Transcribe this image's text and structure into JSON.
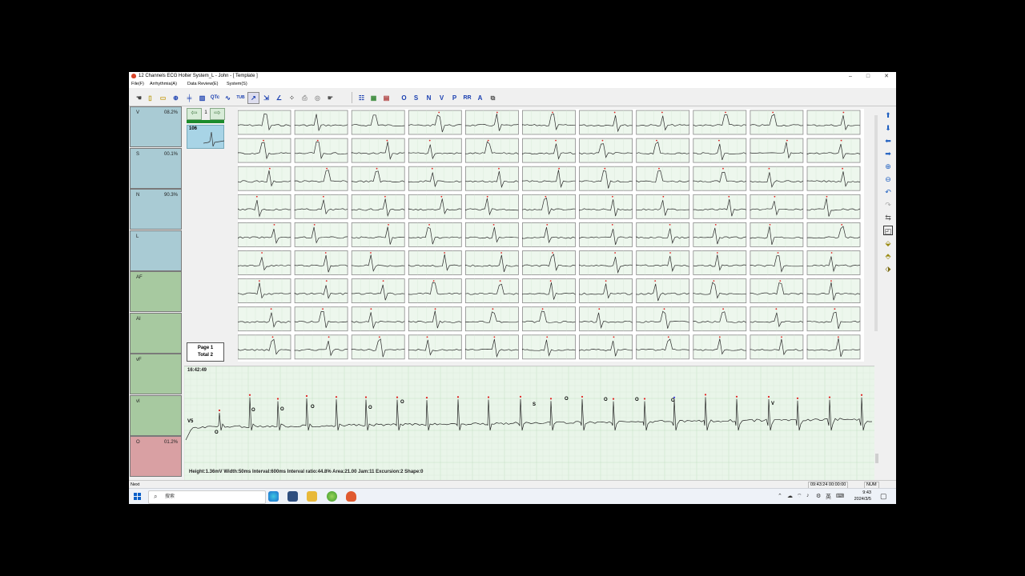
{
  "window": {
    "title": "12 Channels ECG Holter System_L - John - [ Template ]",
    "controls": [
      "–",
      "□",
      "✕"
    ]
  },
  "menu": [
    "File(F)",
    "Arrhythmia(A)",
    "Data Review(E)",
    "System(S)"
  ],
  "toolbar": {
    "icons": [
      "hand-tool-icon",
      "new-file-icon",
      "open-folder-icon",
      "zoom-icon",
      "filter-icon",
      "histogram-icon",
      "qtc-icon",
      "wave-icon",
      "tub-icon",
      "pointer-icon",
      "ruler-icon",
      "angle-icon",
      "grid-icon",
      "print-icon",
      "camera-icon",
      "hand-icon"
    ],
    "labels": {
      "qtc": "QTc",
      "tub": "TUB"
    },
    "beat_buttons": [
      "O",
      "S",
      "N",
      "V",
      "P",
      "RR",
      "A"
    ]
  },
  "categories": [
    {
      "label": "V",
      "percent": "08.2%",
      "color": "#a9cbd4"
    },
    {
      "label": "S",
      "percent": "00.1%",
      "color": "#a9cbd4"
    },
    {
      "label": "N",
      "percent": "90.3%",
      "color": "#a9cbd4"
    },
    {
      "label": "L",
      "percent": "",
      "color": "#a9cbd4"
    },
    {
      "label": "AF",
      "percent": "",
      "color": "#a7c9a0"
    },
    {
      "label": "AI",
      "percent": "",
      "color": "#a7c9a0"
    },
    {
      "label": "vF",
      "percent": "",
      "color": "#a7c9a0"
    },
    {
      "label": "vI",
      "percent": "",
      "color": "#a7c9a0"
    },
    {
      "label": "O",
      "percent": "01.2%",
      "color": "#d9a0a3"
    }
  ],
  "nav": {
    "page_number": "1",
    "thumbnail_count": "106"
  },
  "pager": {
    "page": "Page 1",
    "total": "Total 2"
  },
  "grid": {
    "rows": 9,
    "cols": 11
  },
  "strip": {
    "time": "16:42:49",
    "lead": "V5",
    "beat_labels": [
      "O",
      "O",
      "O",
      "O",
      "O",
      "O",
      "S",
      "O",
      "O",
      "O",
      "O",
      "V"
    ],
    "info": "Height:1.36mV  Width:50ms  Interval:600ms  Interval ratio:44.8%  Area:21.00  Jam:11  Excursion:2  Shape:0"
  },
  "status": {
    "left": "Next",
    "time_range": "09:43:24  00:00:00",
    "num": "NUM"
  },
  "taskbar": {
    "search_placeholder": "搜索",
    "clock_time": "9:43",
    "clock_date": "2024/3/5",
    "ime": "英"
  },
  "colors": {
    "grid_bg": "#edf7ed",
    "beat_marker": "#e02020",
    "strip_bg": "#e9f5e9"
  }
}
